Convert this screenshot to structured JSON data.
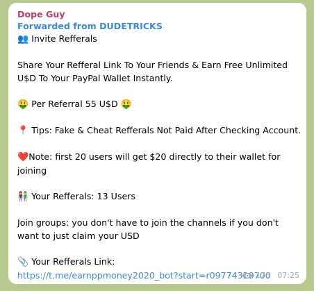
{
  "message": {
    "sender": "Dope Guy",
    "forwarded": "Forwarded from DUDETRICKS",
    "header_icon": "👥",
    "header_text": "Invite Refferals",
    "intro": "Share Your Refferal Link To Your Friends & Earn Free Unlimited U$D To Your PayPal Wallet Instantly.",
    "per_referral_emoji": "🤑",
    "per_referral": "Per Referral 55 U$D",
    "tips_icon": "📍",
    "tips": "Tips: Fake & Cheat Refferals Not Paid After Checking Account.",
    "note_icon": "❤️",
    "note": "Note: first 20 users will get $20 directly to their wallet for joining",
    "referrals_icon": "👫",
    "referrals": "Your Refferals: 13 Users",
    "join_groups": "Join groups: you don't have to join the channels if you don't want to just claim your USD",
    "link_icon": "📎",
    "link_label": "Your Refferals Link:",
    "link_url": "https://t.me/earnppmoney2020_bot?start=r09774329700",
    "views": "175",
    "time": "07:25"
  },
  "colors": {
    "sender": "#c03d6b",
    "forwarded": "#3a8bd8",
    "link": "#3a8bd8",
    "meta": "#a0acb6",
    "background": "#b7c98f"
  },
  "icons": {
    "views": "eye-icon"
  }
}
